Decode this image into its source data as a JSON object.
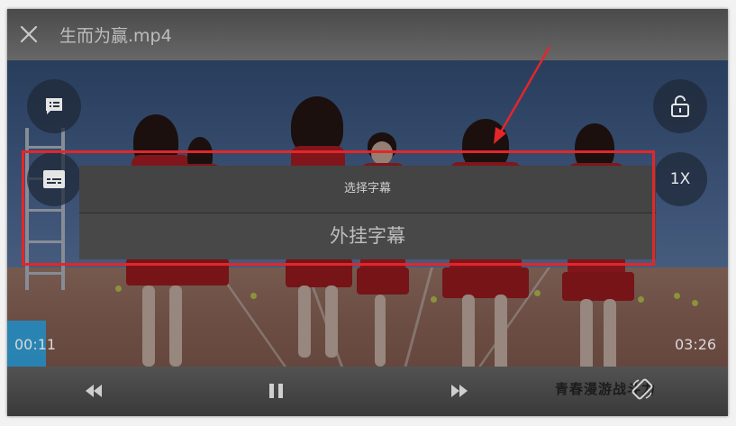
{
  "header": {
    "title": "生而为赢.mp4",
    "close_icon": "close-icon"
  },
  "side_buttons": {
    "danmaku_icon": "comment-list-icon",
    "subtitle_icon": "subtitle-icon",
    "lock_icon": "unlock-icon",
    "rate_label": "1X"
  },
  "subtitle_dialog": {
    "title": "选择字幕",
    "options": [
      "外挂字幕"
    ]
  },
  "playback": {
    "current_time": "00:11",
    "duration": "03:26"
  },
  "controls": {
    "rewind_icon": "rewind-icon",
    "pause_icon": "pause-icon",
    "forward_icon": "fast-forward-icon",
    "rotate_icon": "screen-rotate-icon",
    "watermark_text": "青春漫游战斗力"
  },
  "colors": {
    "accent": "#1e8ec7",
    "annotation": "#e3262a"
  }
}
